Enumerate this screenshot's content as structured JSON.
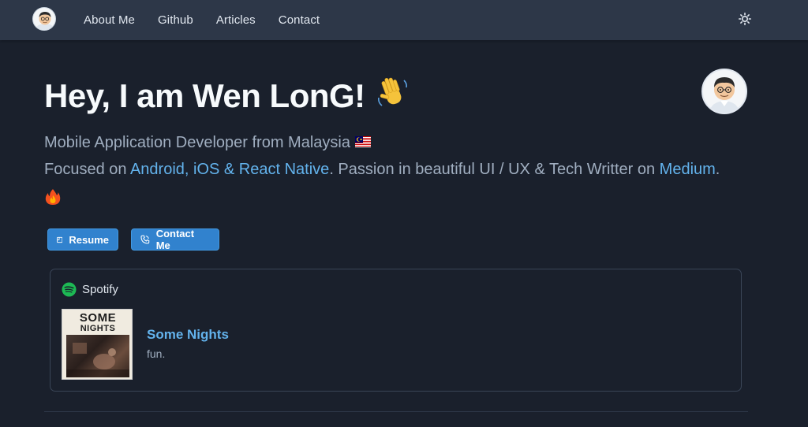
{
  "nav": {
    "links": [
      "About Me",
      "Github",
      "Articles",
      "Contact"
    ]
  },
  "hero": {
    "title": "Hey, I am Wen LonG!",
    "subtitle": "Mobile Application Developer from Malaysia",
    "focus_prefix": "Focused on ",
    "focus_platforms": "Android, iOS & React Native",
    "focus_middle": ". Passion in beautiful UI / UX & Tech Writter on ",
    "focus_medium": "Medium",
    "focus_suffix": "."
  },
  "buttons": {
    "resume": "Resume",
    "contact": "Contact Me"
  },
  "spotify": {
    "label": "Spotify",
    "song": "Some Nights",
    "artist": "fun.",
    "album_line_1": "SOME",
    "album_line_2": "NIGHTS"
  },
  "colors": {
    "background": "#1a202c",
    "navbar": "#2d3748",
    "accent": "#63b3ed",
    "button": "#3182ce",
    "spotify_green": "#1db954"
  },
  "icons": [
    "avatar",
    "sun-icon",
    "wave-icon",
    "malaysia-flag-icon",
    "fire-icon",
    "document-icon",
    "phone-icon",
    "spotify-icon"
  ]
}
